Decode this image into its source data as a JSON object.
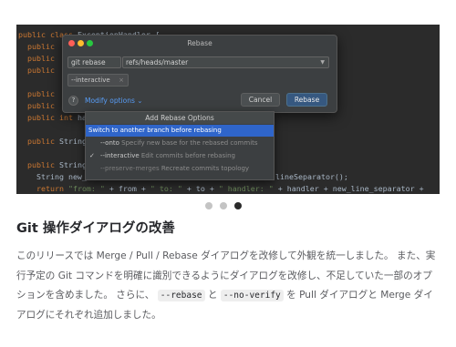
{
  "code_lines": [
    "public class ExceptionHandler {",
    "  public",
    "  public",
    "  public",
    "",
    "  public",
    "  public",
    "  public int ha",
    "",
    "  public String",
    "",
    "  public String",
    "    String new_",
    "    return \"from: \" + from + \" to: \" + to + \" handler: \" + handler + new_line_separator +"
  ],
  "code_right_fragment": "lineSeparator();",
  "dialog": {
    "title": "Rebase",
    "git_field": "git rebase",
    "ref_field": "refs/heads/master",
    "tag": "--interactive",
    "tag_close": "×",
    "help": "?",
    "modify_options": "Modify options",
    "modify_chevron": "⌄",
    "cancel": "Cancel",
    "rebase": "Rebase"
  },
  "popup": {
    "header": "Add Rebase Options",
    "items": [
      {
        "label": "Switch to another branch before rebasing",
        "desc": "",
        "state": "selected"
      },
      {
        "label": "--onto",
        "desc": "Specify new base for the rebased commits",
        "state": "normal"
      },
      {
        "label": "--interactive",
        "desc": "Edit commits before rebasing",
        "state": "checked"
      },
      {
        "label": "--preserve-merges",
        "desc": "Recreate commits topology",
        "state": "disabled"
      }
    ]
  },
  "carousel": {
    "count": 3,
    "active_index": 2
  },
  "heading": "Git 操作ダイアログの改善",
  "paragraph": {
    "part1": "このリリースでは Merge / Pull / Rebase ダイアログを改修して外観を統一しました。 また、実行予定の Git コマンドを明確に識別できるようにダイアログを改修し、不足していた一部のオプションを含めました。 さらに、",
    "code1": "--rebase",
    "part2": " と ",
    "code2": "--no-verify",
    "part3": " を Pull ダイアログと Merge ダイアログにそれぞれ追加しました。"
  }
}
